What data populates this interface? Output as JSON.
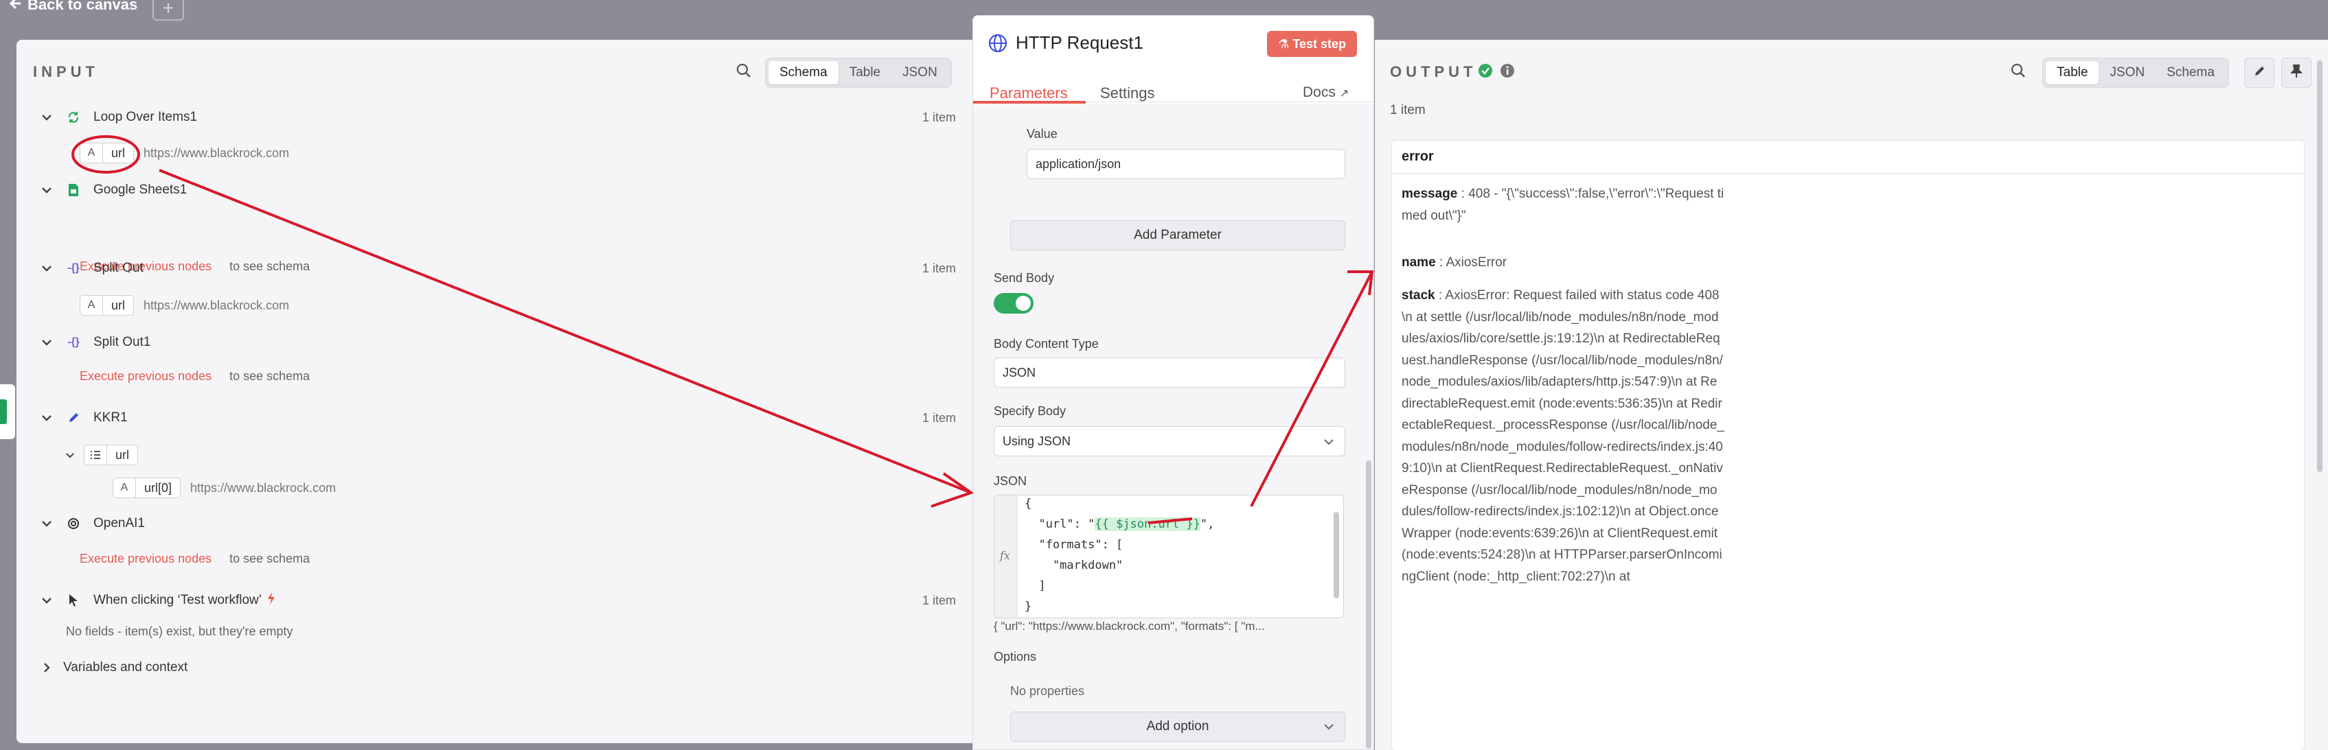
{
  "topbar": {
    "back_label": "Back to canvas"
  },
  "input": {
    "title": "INPUT",
    "view_tabs": [
      "Schema",
      "Table",
      "JSON"
    ],
    "nodes": [
      {
        "name": "Loop Over Items1",
        "count": "1 item",
        "field_type": "A",
        "field_key": "url",
        "field_value": "https://www.blackrock.com"
      },
      {
        "name": "Google Sheets1",
        "exec_link": "Execute previous nodes",
        "exec_rest": "to see schema"
      },
      {
        "name": "Split Out",
        "count": "1 item",
        "field_type": "A",
        "field_key": "url",
        "field_value": "https://www.blackrock.com"
      },
      {
        "name": "Split Out1",
        "exec_link": "Execute previous nodes",
        "exec_rest": "to see schema"
      },
      {
        "name": "KKR1",
        "count": "1 item",
        "sub_key": "url",
        "field_type": "A",
        "field_key": "url[0]",
        "field_value": "https://www.blackrock.com"
      },
      {
        "name": "OpenAI1",
        "exec_link": "Execute previous nodes",
        "exec_rest": "to see schema"
      },
      {
        "name": "When clicking ‘Test workflow’",
        "count": "1 item",
        "empty_msg": "No fields - item(s) exist, but they're empty"
      }
    ],
    "variables_label": "Variables and context"
  },
  "node_panel": {
    "title": "HTTP Request1",
    "test_button": "Test step",
    "tabs": [
      "Parameters",
      "Settings"
    ],
    "docs_label": "Docs",
    "value_label": "Value",
    "value_input": "application/json",
    "add_parameter": "Add Parameter",
    "send_body_label": "Send Body",
    "send_body_on": true,
    "body_content_type_label": "Body Content Type",
    "body_content_type": "JSON",
    "specify_body_label": "Specify Body",
    "specify_body": "Using JSON",
    "json_label": "JSON",
    "json_lines": [
      "{",
      "  \"url\": \"",
      "{{ $json.url }}",
      "\",",
      "  \"formats\": [",
      "    \"markdown\"",
      "  ]",
      "}"
    ],
    "fx_label": "fx",
    "json_preview": "{   \"url\": \"https://www.blackrock.com\",   \"formats\": [    \"m...",
    "options_label": "Options",
    "no_properties": "No properties",
    "add_option": "Add option"
  },
  "output": {
    "title": "OUTPUT",
    "item_count": "1 item",
    "view_tabs": [
      "Table",
      "JSON",
      "Schema"
    ],
    "error_header": "error",
    "message_key": "message",
    "message_value": "408 - \"{\\\"success\\\":false,\\\"error\\\":\\\"Request timed out\\\"}\"",
    "name_key": "name",
    "name_value": "AxiosError",
    "stack_key": "stack",
    "stack_value": "AxiosError: Request failed with status code 408\\n    at settle (/usr/local/lib/node_modules/n8n/node_modules/axios/lib/core/settle.js:19:12)\\n    at RedirectableRequest.handleResponse (/usr/local/lib/node_modules/n8n/node_modules/axios/lib/adapters/http.js:547:9)\\n    at RedirectableRequest.emit (node:events:536:35)\\n    at RedirectableRequest._processResponse (/usr/local/lib/node_modules/n8n/node_modules/follow-redirects/index.js:409:10)\\n    at ClientRequest.RedirectableRequest._onNativeResponse (/usr/local/lib/node_modules/n8n/node_modules/follow-redirects/index.js:102:12)\\n    at Object.onceWrapper (node:events:639:26)\\n    at ClientRequest.emit (node:events:524:28)\\n    at HTTPParser.parserOnIncomingClient (node:_http_client:702:27)\\n    at"
  },
  "colors": {
    "accent": "#e9584f",
    "success": "#2faa5f",
    "annotation": "#d8182b"
  }
}
